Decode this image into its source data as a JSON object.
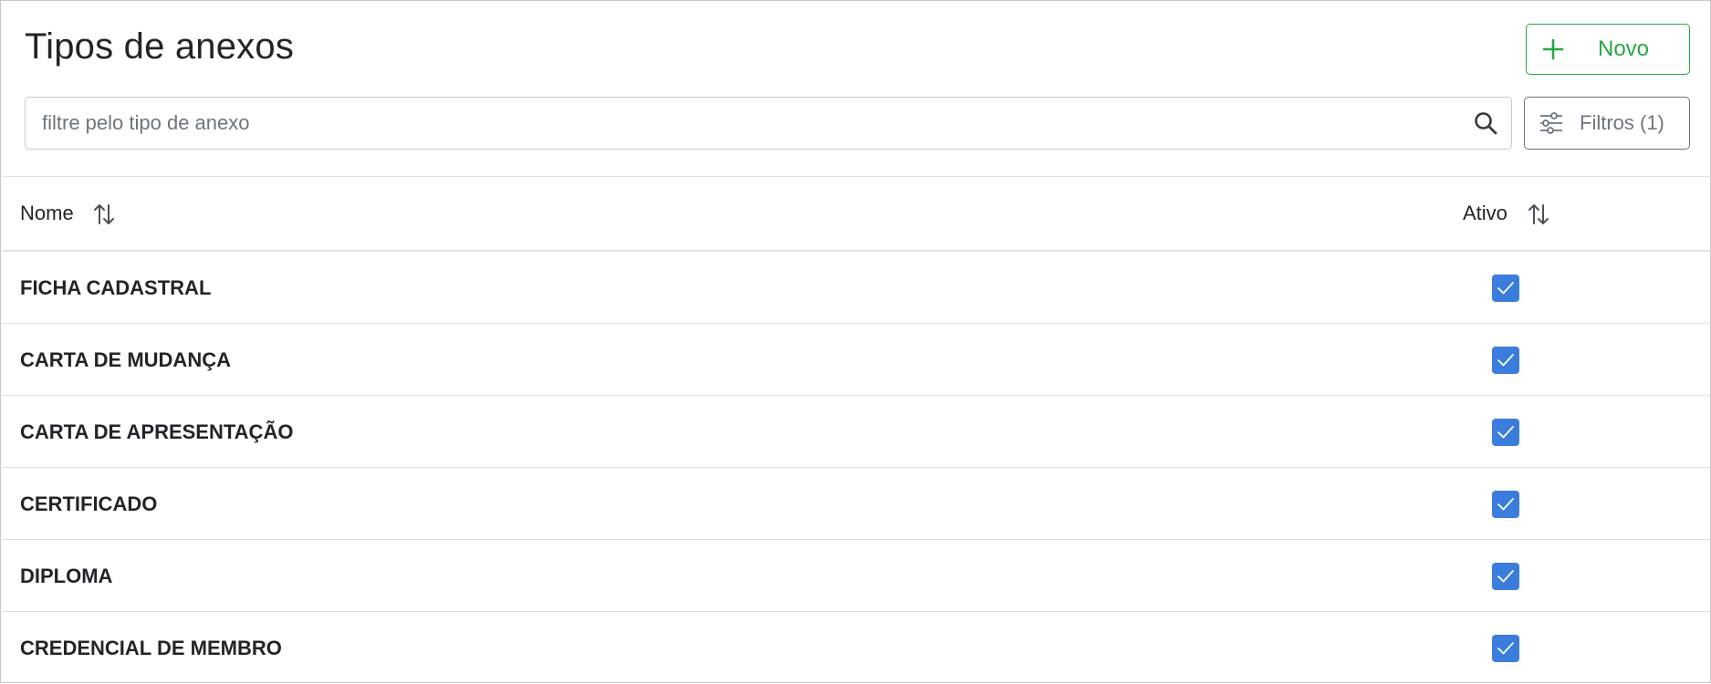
{
  "page": {
    "title": "Tipos de anexos"
  },
  "toolbar": {
    "new_label": "Novo",
    "filter_label": "Filtros (1)"
  },
  "search": {
    "placeholder": "filtre pelo tipo de anexo",
    "value": ""
  },
  "table": {
    "columns": [
      "Nome",
      "Ativo"
    ],
    "rows": [
      {
        "name": "FICHA CADASTRAL",
        "active": true
      },
      {
        "name": "CARTA DE MUDANÇA",
        "active": true
      },
      {
        "name": "CARTA DE APRESENTAÇÃO",
        "active": true
      },
      {
        "name": "CERTIFICADO",
        "active": true
      },
      {
        "name": "DIPLOMA",
        "active": true
      },
      {
        "name": "CREDENCIAL DE MEMBRO",
        "active": true
      }
    ]
  },
  "colors": {
    "accent_green": "#28a745",
    "checkbox_blue": "#3b7ddd",
    "secondary": "#6c757d"
  },
  "icons": {
    "new": "plus-icon",
    "search": "search-icon",
    "filter": "sliders-icon",
    "sort": "sort-arrows-icon",
    "check": "check-icon"
  }
}
